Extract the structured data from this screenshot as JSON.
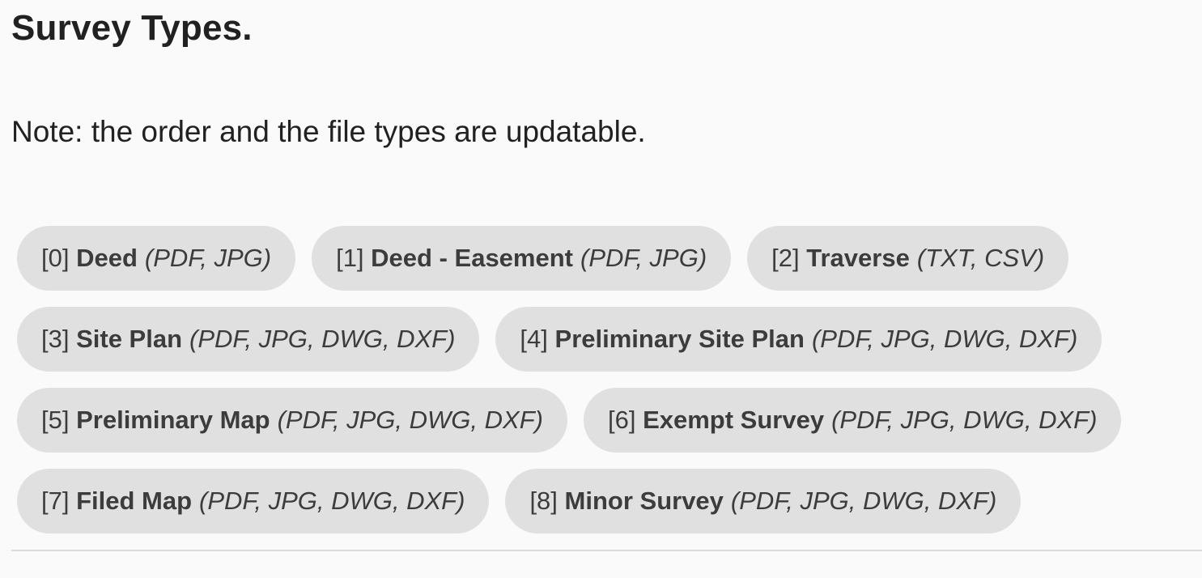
{
  "title": "Survey Types.",
  "note": "Note: the order and the file types are updatable.",
  "chip_rows": [
    [
      {
        "index": "[0]",
        "label": "Deed",
        "types": "(PDF, JPG)"
      },
      {
        "index": "[1]",
        "label": "Deed - Easement",
        "types": "(PDF, JPG)"
      },
      {
        "index": "[2]",
        "label": "Traverse",
        "types": "(TXT, CSV)"
      }
    ],
    [
      {
        "index": "[3]",
        "label": "Site Plan",
        "types": "(PDF, JPG, DWG, DXF)"
      },
      {
        "index": "[4]",
        "label": "Preliminary Site Plan",
        "types": "(PDF, JPG, DWG, DXF)"
      }
    ],
    [
      {
        "index": "[5]",
        "label": "Preliminary Map",
        "types": "(PDF, JPG, DWG, DXF)"
      },
      {
        "index": "[6]",
        "label": "Exempt Survey",
        "types": "(PDF, JPG, DWG, DXF)"
      }
    ],
    [
      {
        "index": "[7]",
        "label": "Filed Map",
        "types": "(PDF, JPG, DWG, DXF)"
      },
      {
        "index": "[8]",
        "label": "Minor Survey",
        "types": "(PDF, JPG, DWG, DXF)"
      }
    ]
  ]
}
